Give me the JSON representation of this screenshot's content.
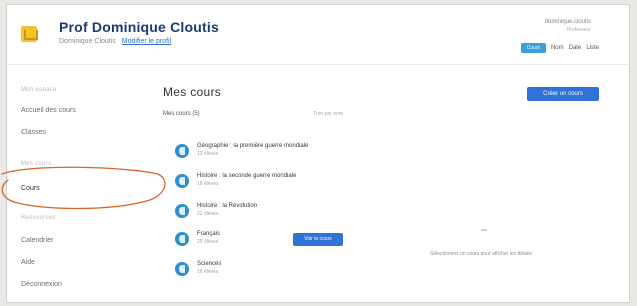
{
  "header": {
    "title": "Prof Dominique Cloutis",
    "subtitle": "Dominique Cloutis",
    "subtitle_link": "Modifier le profil",
    "account_line": "dominique.cloutis",
    "account_sub": "Professeur",
    "pill": "Cours",
    "controls": [
      "Nom",
      "Date",
      "Liste"
    ]
  },
  "sidebar": {
    "head_1": "Mon espace",
    "item_1": "Accueil des cours",
    "item_2": "Classes",
    "head_2": "Mes cours",
    "item_3": "Cours",
    "head_3": "Ressources",
    "item_4": "Calendrier",
    "item_5": "Aide",
    "item_6": "Déconnexion"
  },
  "main": {
    "title": "Mes cours",
    "create_button": "Créer un cours",
    "list_header": "Mes cours (5)",
    "sort_label": "Trier par nom",
    "courses": [
      {
        "name": "Géographie : la première guerre mondiale",
        "meta": "12 élèves"
      },
      {
        "name": "Histoire : la seconde guerre mondiale",
        "meta": "18 élèves"
      },
      {
        "name": "Histoire : la Révolution",
        "meta": "22 élèves"
      },
      {
        "name": "Français",
        "meta": "25 élèves",
        "action": "Voir le cours"
      },
      {
        "name": "Sciences",
        "meta": "16 élèves"
      }
    ],
    "empty_text": "Sélectionnez un cours pour afficher les détails"
  },
  "colors": {
    "accent": "#2f73d8",
    "course_icon": "#2e8fce",
    "title": "#1d3a78",
    "annotation": "#d9652b"
  },
  "icons": {
    "logo": "school-logo-icon",
    "course": "course-icon",
    "annotation": "hand-drawn-circle-annotation"
  }
}
